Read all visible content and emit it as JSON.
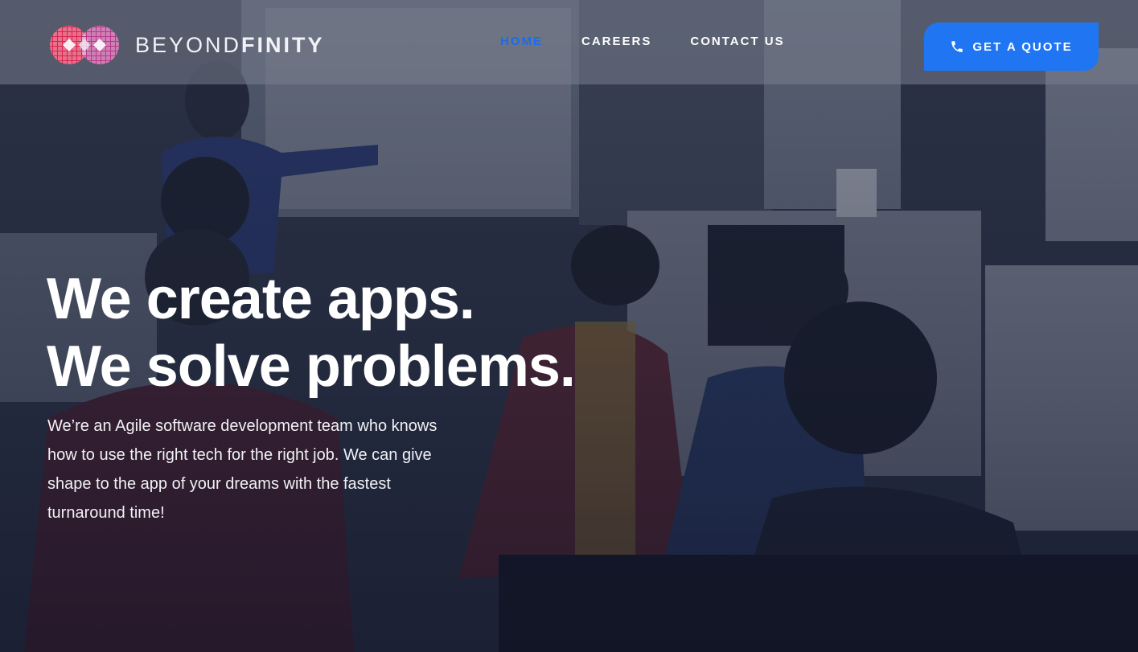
{
  "brand": {
    "name_light": "BEYOND",
    "name_bold": "FINITY",
    "logo_colors": {
      "left": "#d8254f",
      "right": "#b43a8a"
    }
  },
  "nav": {
    "items": [
      {
        "label": "HOME",
        "active": true
      },
      {
        "label": "CAREERS",
        "active": false
      },
      {
        "label": "CONTACT US",
        "active": false
      }
    ]
  },
  "cta": {
    "label": "GET A QUOTE",
    "icon": "phone-icon"
  },
  "hero": {
    "headline_line1": "We create apps.",
    "headline_line2": "We solve problems.",
    "description": "We’re an Agile software development team who knows how to use the right tech for the right job. We can give shape to the app of your dreams with the fastest turnaround time!"
  },
  "colors": {
    "accent": "#1f75f2",
    "nav_active": "#1a6cf0",
    "text": "#ffffff"
  }
}
